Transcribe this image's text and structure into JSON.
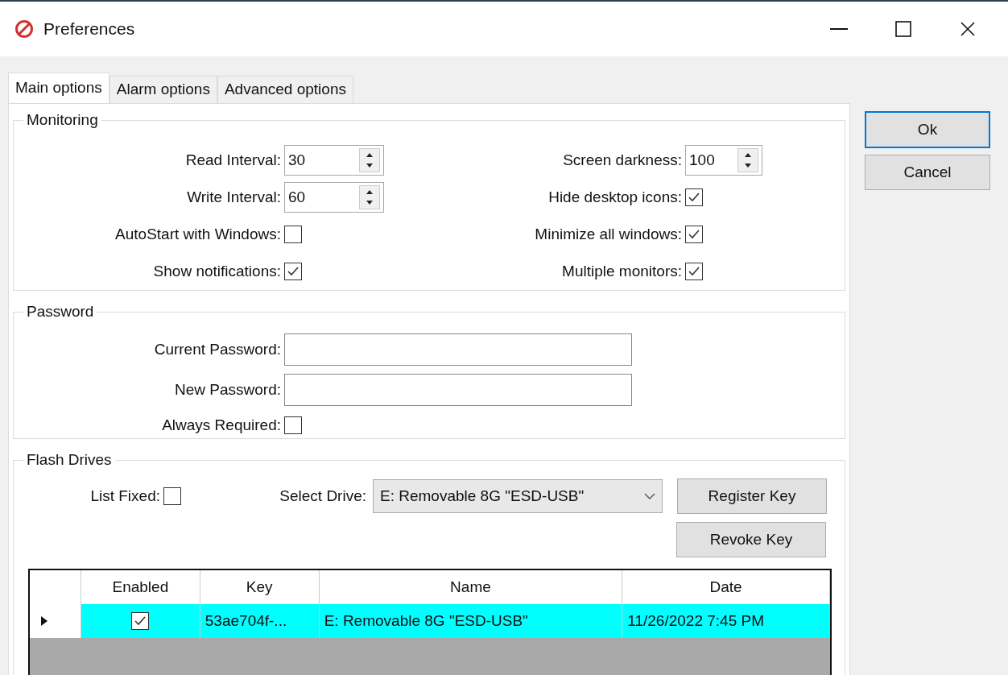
{
  "window": {
    "title": "Preferences"
  },
  "tabs": [
    {
      "label": "Main options",
      "selected": true
    },
    {
      "label": "Alarm options",
      "selected": false
    },
    {
      "label": "Advanced options",
      "selected": false
    }
  ],
  "monitoring": {
    "title": "Monitoring",
    "left": [
      {
        "kind": "spinner",
        "label": "Read Interval:",
        "value": "30"
      },
      {
        "kind": "spinner",
        "label": "Write Interval:",
        "value": "60"
      },
      {
        "kind": "checkbox",
        "label": "AutoStart with Windows:",
        "checked": false
      },
      {
        "kind": "checkbox",
        "label": "Show notifications:",
        "checked": true
      }
    ],
    "right": [
      {
        "kind": "spinner",
        "label": "Screen darkness:",
        "value": "100"
      },
      {
        "kind": "checkbox",
        "label": "Hide desktop icons:",
        "checked": true
      },
      {
        "kind": "checkbox",
        "label": "Minimize all windows:",
        "checked": true
      },
      {
        "kind": "checkbox",
        "label": "Multiple monitors:",
        "checked": true
      }
    ]
  },
  "password": {
    "title": "Password",
    "fields": [
      {
        "label": "Current Password:"
      },
      {
        "label": "New Password:"
      }
    ],
    "always_required": {
      "label": "Always Required:",
      "checked": false
    }
  },
  "flash_drives": {
    "title": "Flash Drives",
    "list_fixed": {
      "label": "List Fixed:",
      "checked": false
    },
    "select_drive": {
      "label": "Select Drive:",
      "value": "E: Removable 8G \"ESD-USB\""
    },
    "buttons": [
      "Register Key",
      "Revoke Key"
    ],
    "table": {
      "columns": [
        "Enabled",
        "Key",
        "Name",
        "Date"
      ],
      "rows": [
        {
          "selected": true,
          "enabled": true,
          "key": "53ae704f-...",
          "name": "E: Removable 8G \"ESD-USB\"",
          "date": "11/26/2022 7:45 PM"
        }
      ]
    }
  },
  "buttons": [
    "Ok",
    "Cancel"
  ]
}
